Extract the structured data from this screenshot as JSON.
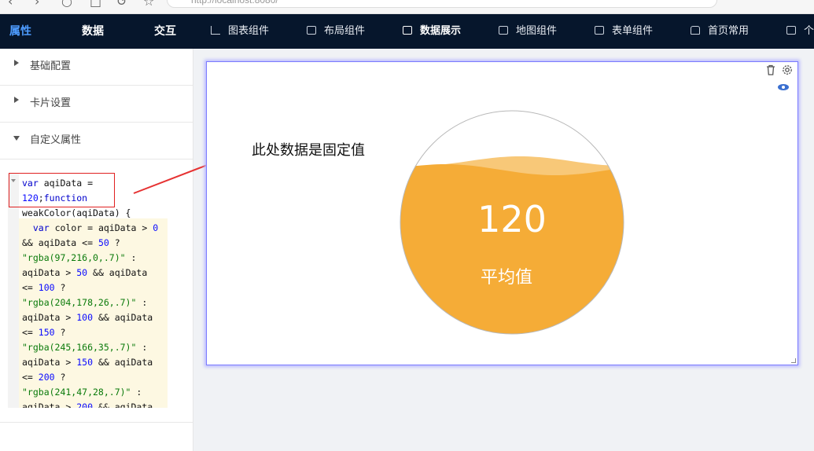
{
  "browser": {
    "url": "http://localhost:8080/"
  },
  "topbar": {
    "tabs": [
      {
        "label": "属性",
        "active": true
      },
      {
        "label": "数据",
        "active": false
      },
      {
        "label": "交互",
        "active": false
      }
    ],
    "menu": [
      {
        "label": "图表组件",
        "icon": "bar-chart-icon"
      },
      {
        "label": "布局组件",
        "icon": "layout-icon"
      },
      {
        "label": "数据展示",
        "icon": "table-icon"
      },
      {
        "label": "地图组件",
        "icon": "grid-map-icon"
      },
      {
        "label": "表单组件",
        "icon": "edit-icon"
      },
      {
        "label": "首页常用",
        "icon": "home-icon"
      },
      {
        "label": "个",
        "icon": "apps-icon"
      }
    ]
  },
  "sidebar": {
    "sections": [
      {
        "label": "基础配置",
        "expanded": false
      },
      {
        "label": "卡片设置",
        "expanded": false
      },
      {
        "label": "自定义属性",
        "expanded": true
      }
    ],
    "code_lines": [
      "var aqiData =",
      "120;function",
      "weakColor(aqiData) {",
      "  var color = aqiData > 0",
      "&& aqiData <= 50 ?",
      "\"rgba(97,216,0,.7)\" :",
      "aqiData > 50 && aqiData",
      "<= 100 ?",
      "\"rgba(204,178,26,.7)\" :",
      "aqiData > 100 && aqiData",
      "<= 150 ?",
      "\"rgba(245,166,35,.7)\" :",
      "aqiData > 150 && aqiData",
      "<= 200 ?",
      "\"rgba(241,47,28,.7)\" :",
      "aqiData > 200 && aqiData"
    ]
  },
  "canvas": {
    "annotation": "此处数据是固定值",
    "gauge": {
      "value": "120",
      "label": "平均值",
      "fill_level": 0.75,
      "fill_color": "#f5ac37",
      "wave_color": "#f8c878"
    }
  },
  "colors": {
    "topbar_bg": "#06162c",
    "active_tab": "#4e9cff",
    "arrow": "#e63232",
    "selection_border": "#7a7aff"
  }
}
